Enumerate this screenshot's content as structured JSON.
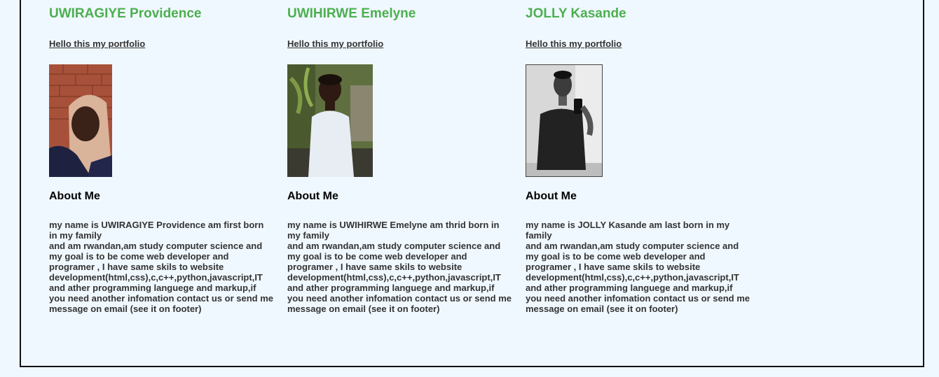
{
  "profiles": [
    {
      "name": "UWIRAGIYE Providence",
      "link_text": "Hello this my portfolio",
      "about_heading": "About Me",
      "bio_line_1": "my name is UWIRAGIYE Providence am first born in my family",
      "bio_line_2": "and am rwandan,am study computer science and my goal is to be come web developer and programer , I have same skils to website development(html,css),c,c++,python,javascript,IT and ather programming languege and markup,if you need another infomation contact us or send me message on email (see it on footer)"
    },
    {
      "name": "UWIHIRWE Emelyne",
      "link_text": "Hello this my portfolio",
      "about_heading": "About Me",
      "bio_line_1": "my name is UWIHIRWE Emelyne am thrid born in my family",
      "bio_line_2": "and am rwandan,am study computer science and my goal is to be come web developer and programer , I have same skils to website development(html,css),c,c++,python,javascript,IT and ather programming languege and markup,if you need another infomation contact us or send me message on email (see it on footer)"
    },
    {
      "name": "JOLLY Kasande",
      "link_text": "Hello this my portfolio",
      "about_heading": "About Me",
      "bio_line_1": "my name is JOLLY Kasande am last born in my family",
      "bio_line_2": "and am rwandan,am study computer science and my goal is to be come web developer and programer , I have same skils to website development(html,css),c,c++,python,javascript,IT and ather programming languege and markup,if you need another infomation contact us or send me message on email (see it on footer)"
    }
  ],
  "colors": {
    "page_background": "#f0f8ff",
    "name_green": "#4caf50",
    "frame_border": "#111111"
  }
}
